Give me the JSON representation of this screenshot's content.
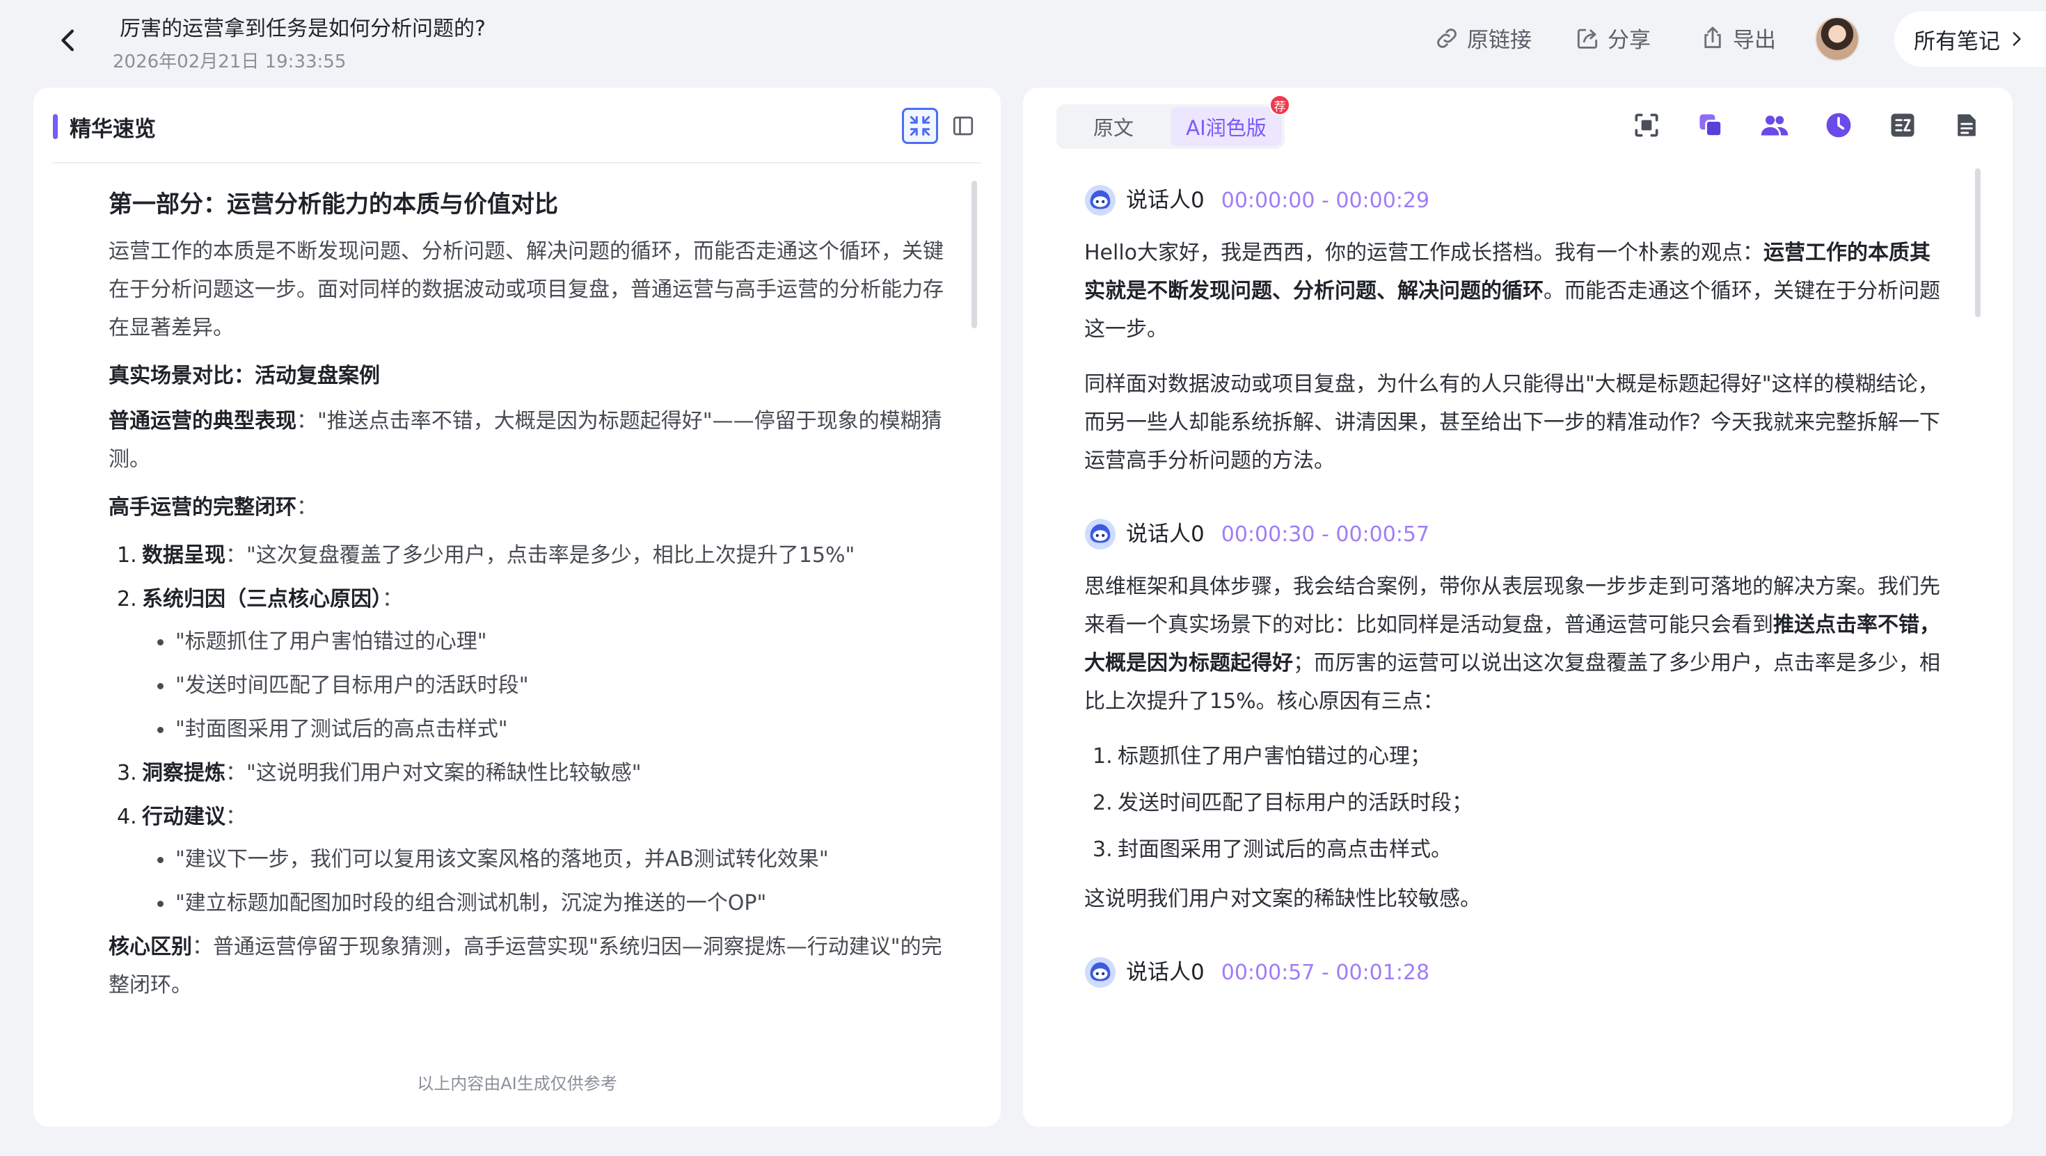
{
  "header": {
    "title": "厉害的运营拿到任务是如何分析问题的?",
    "timestamp": "2026年02月21日 19:33:55",
    "actions": {
      "original_link": "原链接",
      "share": "分享",
      "export": "导出"
    },
    "all_notes": "所有笔记"
  },
  "left_panel": {
    "title": "精华速览",
    "heading": "第一部分：运营分析能力的本质与价值对比",
    "intro": "运营工作的本质是不断发现问题、分析问题、解决问题的循环，而能否走通这个循环，关键在于分析问题这一步。面对同样的数据波动或项目复盘，普通运营与高手运营的分析能力存在显著差异。",
    "scenario_title": "真实场景对比：活动复盘案例",
    "ordinary": {
      "label": "普通运营的典型表现",
      "sep": "：",
      "text": "\"推送点击率不错，大概是因为标题起得好\"——停留于现象的模糊猜测。"
    },
    "expert_title": "高手运营的完整闭环",
    "expert_title_sep": "：",
    "steps": [
      {
        "num": "1.",
        "label": "数据呈现",
        "text": "：\"这次复盘覆盖了多少用户，点击率是多少，相比上次提升了15%\""
      },
      {
        "num": "2.",
        "label": "系统归因（三点核心原因）",
        "text": "："
      },
      {
        "num": "3.",
        "label": "洞察提炼",
        "text": "：\"这说明我们用户对文案的稀缺性比较敏感\""
      },
      {
        "num": "4.",
        "label": "行动建议",
        "text": "："
      }
    ],
    "reasons": [
      "\"标题抓住了用户害怕错过的心理\"",
      "\"发送时间匹配了目标用户的活跃时段\"",
      "\"封面图采用了测试后的高点击样式\""
    ],
    "suggestions": [
      "\"建议下一步，我们可以复用该文案风格的落地页，并AB测试转化效果\"",
      "\"建立标题加配图加时段的组合测试机制，沉淀为推送的一个OP\""
    ],
    "core_diff": {
      "label": "核心区别",
      "text": "：普通运营停留于现象猜测，高手运营实现\"系统归因—洞察提炼—行动建议\"的完整闭环。"
    },
    "footnote": "以上内容由AI生成仅供参考"
  },
  "right_panel": {
    "tabs": {
      "original": "原文",
      "ai": "AI润色版"
    },
    "badge": "荐",
    "tools": [
      "screenshot-icon",
      "copy-icon",
      "speakers-icon",
      "clock-icon",
      "translate-icon",
      "document-icon"
    ],
    "segments": [
      {
        "speaker": "说话人0",
        "time": "00:00:00 - 00:00:29",
        "p1_a": "Hello大家好，我是西西，你的运营工作成长搭档。我有一个朴素的观点：",
        "p1_b": "运营工作的本质其实就是不断发现问题、分析问题、解决问题的循环",
        "p1_c": "。而能否走通这个循环，关键在于分析问题这一步。",
        "p2": "同样面对数据波动或项目复盘，为什么有的人只能得出\"大概是标题起得好\"这样的模糊结论，而另一些人却能系统拆解、讲清因果，甚至给出下一步的精准动作？今天我就来完整拆解一下运营高手分析问题的方法。"
      },
      {
        "speaker": "说话人0",
        "time": "00:00:30 - 00:00:57",
        "p1_a": "思维框架和具体步骤，我会结合案例，带你从表层现象一步步走到可落地的解决方案。我们先来看一个真实场景下的对比：比如同样是活动复盘，普通运营可能只会看到",
        "p1_b": "推送点击率不错，大概是因为标题起得好",
        "p1_c": "；而厉害的运营可以说出这次复盘覆盖了多少用户，点击率是多少，相比上次提升了15%。核心原因有三点：",
        "list": [
          {
            "num": "1.",
            "text": "标题抓住了用户害怕错过的心理；"
          },
          {
            "num": "2.",
            "text": "发送时间匹配了目标用户的活跃时段；"
          },
          {
            "num": "3.",
            "text": "封面图采用了测试后的高点击样式。"
          }
        ],
        "p2": "这说明我们用户对文案的稀缺性比较敏感。"
      },
      {
        "speaker": "说话人0",
        "time": "00:00:57 - 00:01:28"
      }
    ]
  },
  "colors": {
    "accent": "#7a5af8",
    "active_blue": "#4c6ef5",
    "badge_red": "#f0394b",
    "time_purple": "#a07df5"
  }
}
